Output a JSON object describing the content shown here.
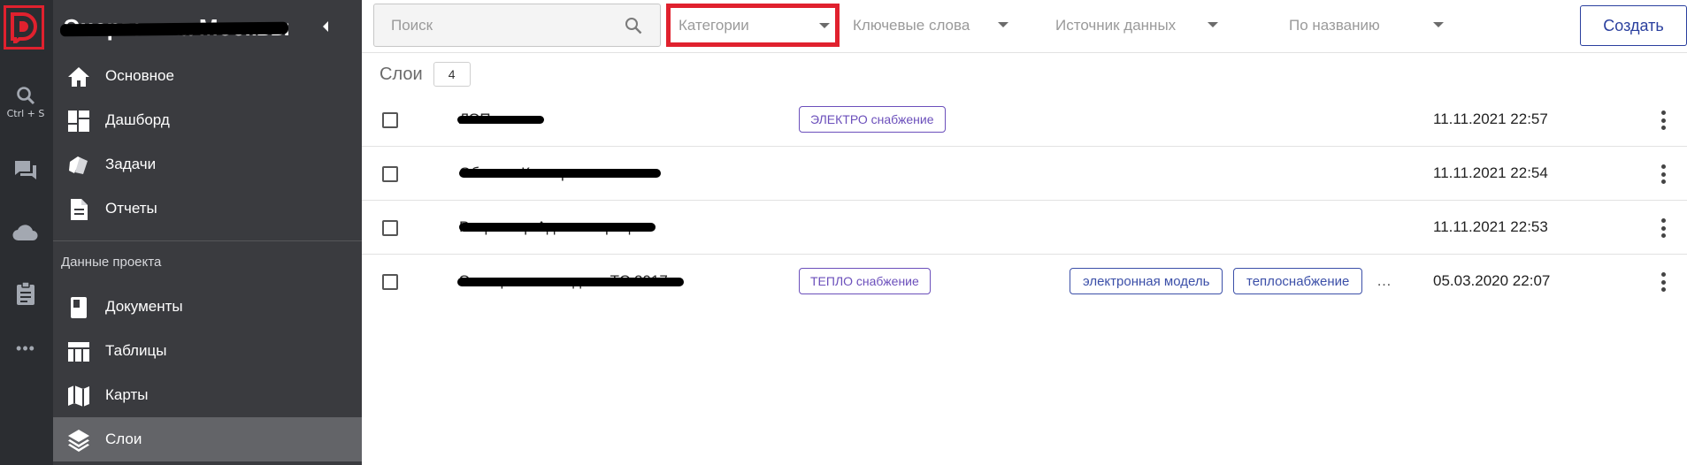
{
  "app": {
    "title": "Энергетика Москвы",
    "logo_letter": "D",
    "brand_color": "#e0212e"
  },
  "rail": {
    "search_hint": "Ctrl + S",
    "more_glyph": "•••"
  },
  "sidebar": {
    "items_top": [
      {
        "label": "Основное",
        "icon": "home-icon"
      },
      {
        "label": "Дашборд",
        "icon": "dashboard-icon"
      },
      {
        "label": "Задачи",
        "icon": "tasks-icon"
      },
      {
        "label": "Отчеты",
        "icon": "report-icon"
      }
    ],
    "section_label": "Данные проекта",
    "items_project": [
      {
        "label": "Документы",
        "icon": "document-icon"
      },
      {
        "label": "Таблицы",
        "icon": "table-icon"
      },
      {
        "label": "Карты",
        "icon": "map-icon"
      },
      {
        "label": "Слои",
        "icon": "layers-icon",
        "active": true
      }
    ]
  },
  "toolbar": {
    "search_placeholder": "Поиск",
    "filters": [
      {
        "label": "Категории",
        "highlighted": true
      },
      {
        "label": "Ключевые слова"
      },
      {
        "label": "Источник данных"
      },
      {
        "label": "По названию"
      }
    ],
    "create_label": "Создать"
  },
  "layers": {
    "title": "Слои",
    "count": "4",
    "rows": [
      {
        "name": "ЛЭП линии",
        "category": "ЭЛЕКТРО снабжение",
        "keywords": [],
        "more": "",
        "date": "11.11.2021 22:57"
      },
      {
        "name": "ОбъектыКапстроительства",
        "category": "",
        "keywords": [],
        "more": "",
        "date": "11.11.2021 22:54"
      },
      {
        "name": "Росреестр Администрации",
        "category": "",
        "keywords": [],
        "more": "",
        "date": "11.11.2021 22:53"
      },
      {
        "name": "Электронная модель ТС 2017",
        "category": "ТЕПЛО снабжение",
        "keywords": [
          "электронная модель",
          "теплоснабжение"
        ],
        "more": "…",
        "date": "05.03.2020 22:07"
      }
    ]
  }
}
